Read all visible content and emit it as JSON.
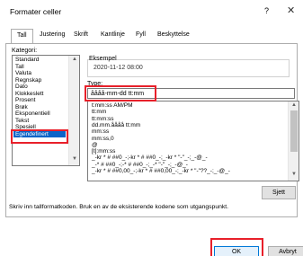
{
  "dialog": {
    "title": "Formater celler",
    "help": "?",
    "close": "✕"
  },
  "tabs": [
    "Tall",
    "Justering",
    "Skrift",
    "Kantlinje",
    "Fyll",
    "Beskyttelse"
  ],
  "category": {
    "label": "Kategori:",
    "items": [
      "Standard",
      "Tall",
      "Valuta",
      "Regnskap",
      "Dato",
      "Klokkeslett",
      "Prosent",
      "Brøk",
      "Eksponentiell",
      "Tekst",
      "Spesiell",
      "Egendefinert"
    ],
    "selected": "Egendefinert"
  },
  "example": {
    "label": "Eksempel",
    "value": "2020-11-12 08:00"
  },
  "type": {
    "label": "Type:",
    "value": "åååå-mm-dd tt:mm"
  },
  "formats": [
    "t:mm:ss AM/PM",
    "tt:mm",
    "tt:mm:ss",
    "dd.mm.åååå tt:mm",
    "mm:ss",
    "mm:ss,0",
    "@",
    "[t]:mm:ss",
    "_-kr * # ##0_-;-kr * # ##0_-;_-kr * \"-\"_-;_-@_-",
    "_-* # ##0_-;-* # ##0_-;_-* \"-\"_-;_-@_-",
    "_-kr * # ##0,00_-;-kr * # ##0,00_-;_-kr * \"-\"??_-;_-@_-"
  ],
  "buttons": {
    "delete": "Sjett",
    "ok": "OK",
    "cancel": "Avbryt"
  },
  "hint": "Skriv inn tallformatkoden. Bruk en av de eksisterende kodene som utgangspunkt.",
  "colors": {
    "selection": "#0a64c8",
    "highlight": "#e8202a"
  }
}
